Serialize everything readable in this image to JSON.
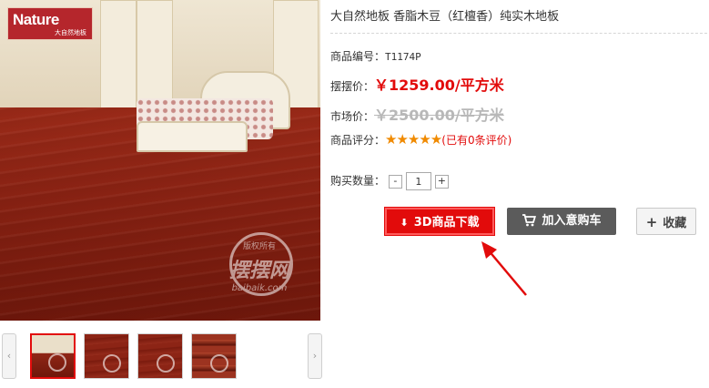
{
  "brand": {
    "logo_text": "Nature",
    "logo_sub": "大自然地板"
  },
  "watermark": {
    "top": "版权所有",
    "big": "摆摆网",
    "url": "baibaik.com"
  },
  "product": {
    "title": "大自然地板 香脂木豆（红檀香）纯实木地板",
    "code_label": "商品编号：",
    "code": "T1174P",
    "price_label": "摆摆价：",
    "price": "￥1259.00/平方米",
    "market_label": "市场价：",
    "market_price": "￥2500.00/平方米",
    "rating_label": "商品评分：",
    "stars": "★★★★★",
    "rating_value": 5,
    "review_count": "(已有0条评价)",
    "qty_label": "购买数量：",
    "qty_minus": "-",
    "qty_value": "1",
    "qty_plus": "+"
  },
  "actions": {
    "download_label": "3D商品下载",
    "cart_label": "加入意购车",
    "favorite_label": "收藏",
    "favorite_icon": "plus-icon"
  },
  "thumbnails": {
    "prev": "‹",
    "next": "›",
    "count": 4,
    "active_index": 0
  },
  "colors": {
    "accent_red": "#e20b0b",
    "cart_gray": "#5b5b5b",
    "star_orange": "#f08a00"
  }
}
